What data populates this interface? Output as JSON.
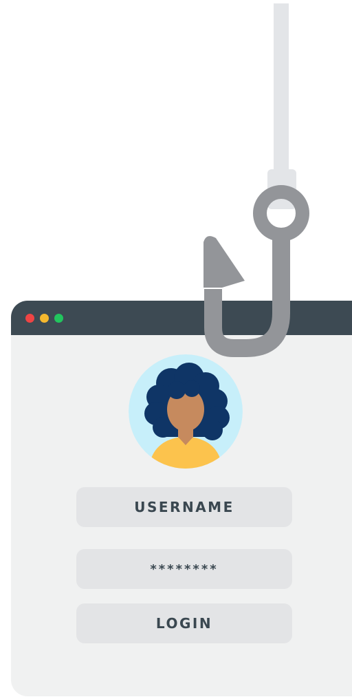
{
  "login_window": {
    "window_controls": {
      "close_color": "#ef4444",
      "minimize_color": "#f5b82e",
      "maximize_color": "#22c55e"
    },
    "avatar": {
      "icon": "user-avatar-icon",
      "background_color": "#c7effa",
      "hair_color": "#0f3566",
      "skin_color": "#c68a5e",
      "shirt_color": "#fcc34d"
    },
    "username_field": {
      "placeholder": "USERNAME"
    },
    "password_field": {
      "value": "********"
    },
    "login_button": {
      "label": "LOGIN"
    }
  },
  "phishing_hook": {
    "icon": "fishing-hook-icon",
    "line_color": "#e3e5e8",
    "hook_color": "#939599"
  }
}
